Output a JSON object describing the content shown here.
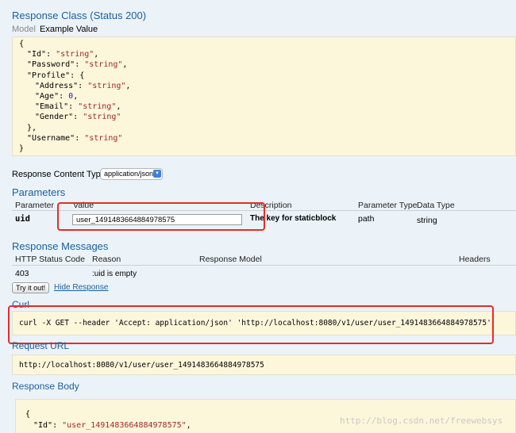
{
  "response_class": {
    "title": "Response Class (Status 200)",
    "tab_model": "Model",
    "tab_example": "Example Value",
    "json_lines": [
      {
        "indent": 0,
        "parts": [
          {
            "t": "{",
            "c": "json-key"
          }
        ]
      },
      {
        "indent": 1,
        "parts": [
          {
            "t": "\"Id\": ",
            "c": "json-key"
          },
          {
            "t": "\"string\"",
            "c": "json-str"
          },
          {
            "t": ",",
            "c": "json-key"
          }
        ]
      },
      {
        "indent": 1,
        "parts": [
          {
            "t": "\"Password\": ",
            "c": "json-key"
          },
          {
            "t": "\"string\"",
            "c": "json-str"
          },
          {
            "t": ",",
            "c": "json-key"
          }
        ]
      },
      {
        "indent": 1,
        "parts": [
          {
            "t": "\"Profile\": {",
            "c": "json-key"
          }
        ]
      },
      {
        "indent": 2,
        "parts": [
          {
            "t": "\"Address\": ",
            "c": "json-key"
          },
          {
            "t": "\"string\"",
            "c": "json-str"
          },
          {
            "t": ",",
            "c": "json-key"
          }
        ]
      },
      {
        "indent": 2,
        "parts": [
          {
            "t": "\"Age\": ",
            "c": "json-key"
          },
          {
            "t": "0",
            "c": "json-num"
          },
          {
            "t": ",",
            "c": "json-key"
          }
        ]
      },
      {
        "indent": 2,
        "parts": [
          {
            "t": "\"Email\": ",
            "c": "json-key"
          },
          {
            "t": "\"string\"",
            "c": "json-str"
          },
          {
            "t": ",",
            "c": "json-key"
          }
        ]
      },
      {
        "indent": 2,
        "parts": [
          {
            "t": "\"Gender\": ",
            "c": "json-key"
          },
          {
            "t": "\"string\"",
            "c": "json-str"
          }
        ]
      },
      {
        "indent": 1,
        "parts": [
          {
            "t": "},",
            "c": "json-key"
          }
        ]
      },
      {
        "indent": 1,
        "parts": [
          {
            "t": "\"Username\": ",
            "c": "json-key"
          },
          {
            "t": "\"string\"",
            "c": "json-str"
          }
        ]
      },
      {
        "indent": 0,
        "parts": [
          {
            "t": "}",
            "c": "json-key"
          }
        ]
      }
    ]
  },
  "content_type": {
    "label": "Response Content Type",
    "value": "application/json"
  },
  "parameters": {
    "title": "Parameters",
    "headers": [
      "Parameter",
      "Value",
      "Description",
      "Parameter Type",
      "Data Type"
    ],
    "row": {
      "name": "uid",
      "value": "user_1491483664884978575",
      "description": "The key for staticblock",
      "param_type": "path",
      "data_type": "string"
    }
  },
  "response_messages": {
    "title": "Response Messages",
    "headers": [
      "HTTP Status Code",
      "Reason",
      "Response Model",
      "Headers"
    ],
    "row": {
      "code": "403",
      "reason": ":uid is empty"
    }
  },
  "actions": {
    "try_it": "Try it out!",
    "hide": "Hide Response"
  },
  "curl": {
    "title": "Curl",
    "command": "curl -X GET --header 'Accept: application/json' 'http://localhost:8080/v1/user/user_1491483664884978575'"
  },
  "request_url": {
    "title": "Request URL",
    "url": "http://localhost:8080/v1/user/user_1491483664884978575"
  },
  "response_body": {
    "title": "Response Body",
    "line1": "{",
    "line2_key": "\"Id\": ",
    "line2_val": "\"user_1491483664884978575\"",
    "line2_end": ","
  },
  "watermark": "http://blog.csdn.net/freewebsys",
  "colors": {
    "accent": "#1a5f9e",
    "highlight_border": "#e62b2b",
    "code_bg": "#fcf6db",
    "page_bg": "#ebf3f9"
  }
}
